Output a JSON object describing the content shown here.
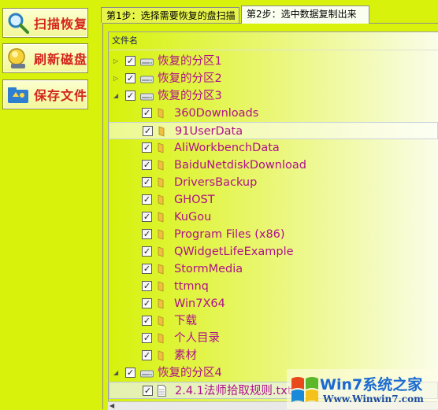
{
  "sidebar": {
    "buttons": [
      {
        "label": "扫描恢复",
        "icon": "magnifier-icon"
      },
      {
        "label": "刷新磁盘",
        "icon": "refresh-disk-icon"
      },
      {
        "label": "保存文件",
        "icon": "save-folder-icon"
      }
    ]
  },
  "tabs": [
    {
      "label": "第1步：选择需要恢复的盘扫描",
      "active": false
    },
    {
      "label": "第2步：选中数据复制出来",
      "active": true
    }
  ],
  "tree": {
    "column_header": "文件名",
    "partitions": [
      {
        "label": "恢复的分区1",
        "expanded": false,
        "checked": true
      },
      {
        "label": "恢复的分区2",
        "expanded": false,
        "checked": true
      },
      {
        "label": "恢复的分区3",
        "expanded": true,
        "checked": true
      },
      {
        "label": "恢复的分区4",
        "expanded": true,
        "checked": true
      }
    ],
    "partition3_folders": [
      "360Downloads",
      "91UserData",
      "AliWorkbenchData",
      "BaiduNetdiskDownload",
      "DriversBackup",
      "GHOST",
      "KuGou",
      "Program Files (x86)",
      "QWidgetLifeExample",
      "StormMedia",
      "ttmnq",
      "Win7X64",
      "下载",
      "个人目录",
      "素材"
    ],
    "partition4_files": [
      "2.4.1法师拾取规则.txt"
    ]
  },
  "watermark": {
    "brand": "Win7系统之家",
    "url": "Www.Winwin7.com"
  },
  "colors": {
    "background": "#d9f20c",
    "button_text": "#d4241c",
    "item_text": "#b0118a"
  }
}
